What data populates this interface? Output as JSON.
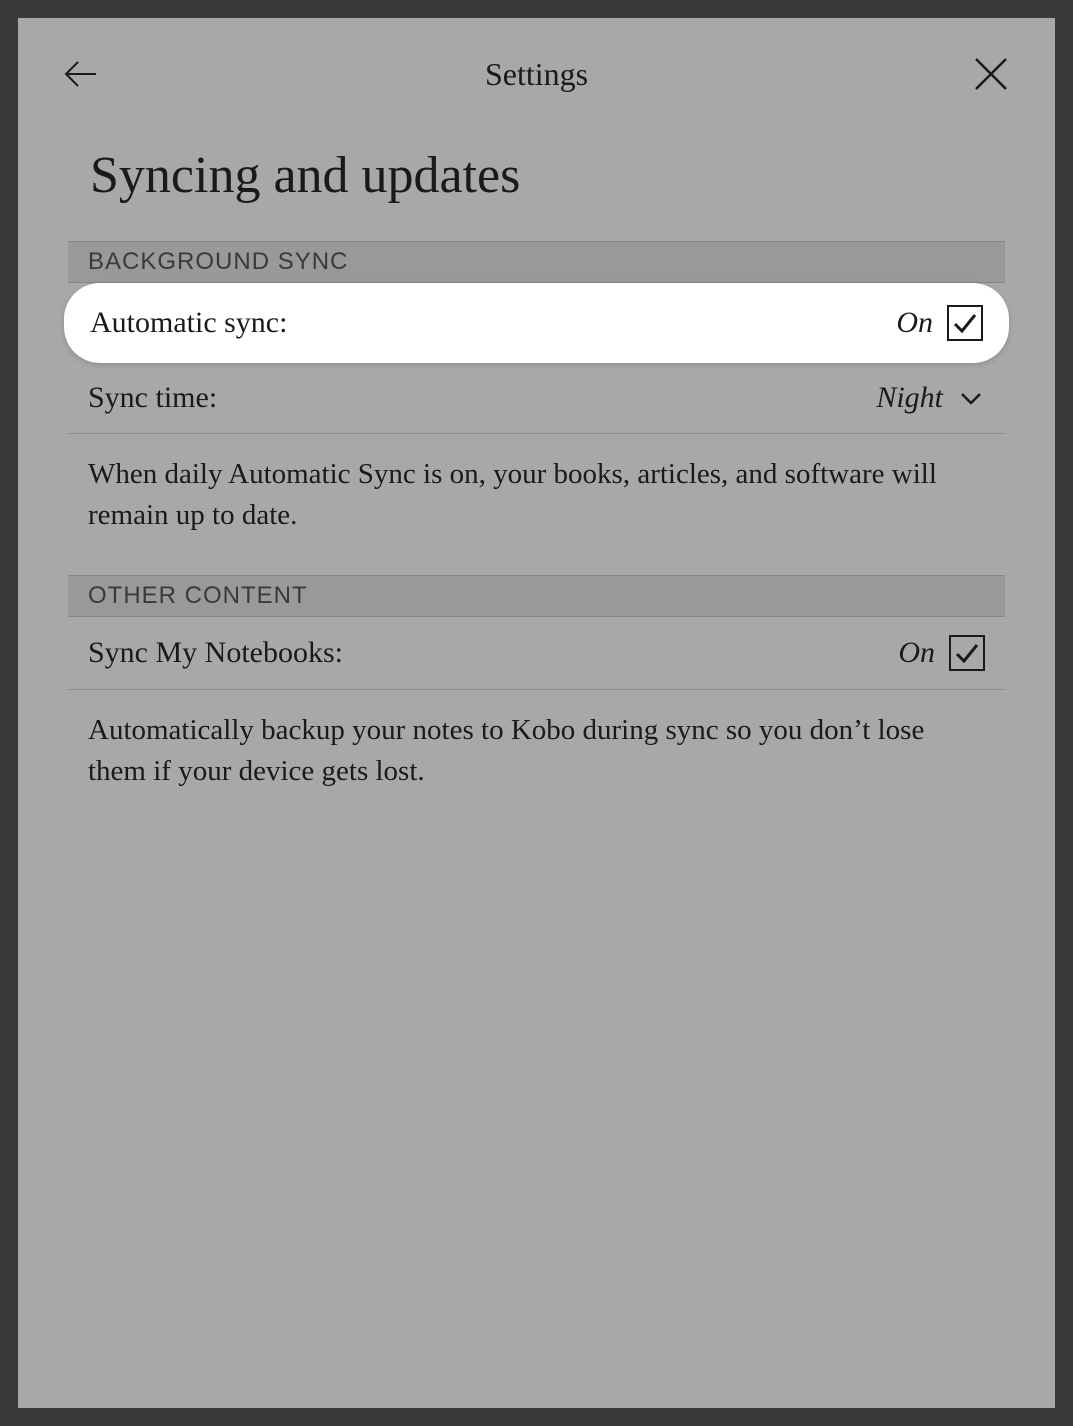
{
  "topbar": {
    "title": "Settings"
  },
  "page": {
    "title": "Syncing and updates"
  },
  "sections": {
    "background_sync": {
      "header": "BACKGROUND SYNC",
      "auto_sync": {
        "label": "Automatic sync:",
        "value": "On"
      },
      "sync_time": {
        "label": "Sync time:",
        "value": "Night"
      },
      "description": "When daily Automatic Sync is on, your books, articles, and software will remain up to date."
    },
    "other_content": {
      "header": "OTHER CONTENT",
      "sync_notebooks": {
        "label": "Sync My Notebooks:",
        "value": "On"
      },
      "description": "Automatically backup your notes to Kobo during sync so you don’t lose them if your device gets lost."
    }
  }
}
